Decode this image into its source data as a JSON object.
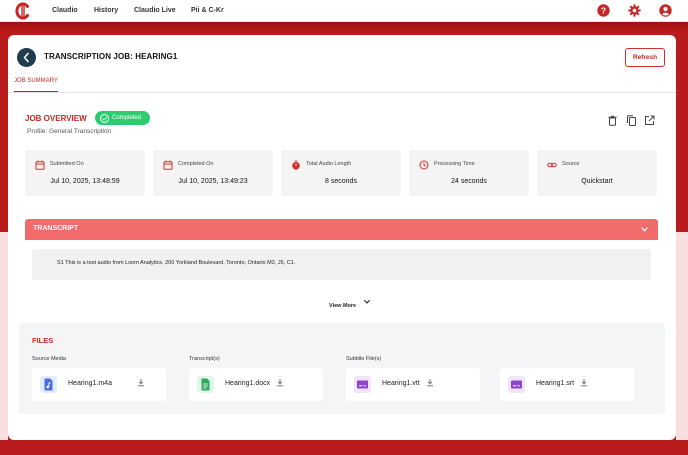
{
  "topnav": {
    "logo_letter": "C",
    "items": [
      {
        "label": "Claudio"
      },
      {
        "label": "History"
      },
      {
        "label": "Claudio Live"
      },
      {
        "label": "Pii & C-Kr"
      }
    ],
    "right_icons": [
      "help-icon",
      "settings-icon",
      "account-icon"
    ]
  },
  "header": {
    "title": "TRANSCRIPTION JOB: HEARING1",
    "refresh_label": "Refresh",
    "tab_label": "JOB SUMMARY"
  },
  "overview": {
    "title": "JOB OVERVIEW",
    "status": "Completed",
    "profile": "Profile: General Transcription",
    "actions": [
      "delete-icon",
      "copy-icon",
      "open-external-icon"
    ]
  },
  "stats": [
    {
      "icon": "calendar-icon",
      "label": "Submitted On",
      "value": "Jul 10, 2025, 13:48:59"
    },
    {
      "icon": "calendar-icon",
      "label": "Completed On",
      "value": "Jul 10, 2025, 13:49:23"
    },
    {
      "icon": "timer-icon",
      "label": "Total Audio Length",
      "value": "8 seconds"
    },
    {
      "icon": "clock-icon",
      "label": "Processing Time",
      "value": "24 seconds"
    },
    {
      "icon": "link-icon",
      "label": "Source",
      "value": "Quickstart"
    }
  ],
  "transcript": {
    "title": "TRANSCRIPT",
    "text": "S1 This is a test audio from Loom Analytics, 200 Yorkland Boulevard, Toronto, Ontario M2, J5, C1.",
    "view_more": "View More"
  },
  "files": {
    "title": "FILES",
    "columns": [
      {
        "label": "Source Media",
        "file": "Hearing1.m4a",
        "icon": "audio-file-icon"
      },
      {
        "label": "Transcript(s)",
        "file": "Hearing1.docx",
        "icon": "doc-file-icon"
      },
      {
        "label": "Subtitle File(s)",
        "file": "Hearing1.vtt",
        "icon": "subtitle-file-icon"
      },
      {
        "label": "",
        "file": "Hearing1.srt",
        "icon": "subtitle-file-icon"
      }
    ]
  },
  "colors": {
    "brand_red": "#c62828",
    "header_band": "#b91c1c",
    "status_green": "#2ecc71",
    "transcript_header": "#f26b6b",
    "back_button": "#1f3b4d"
  }
}
